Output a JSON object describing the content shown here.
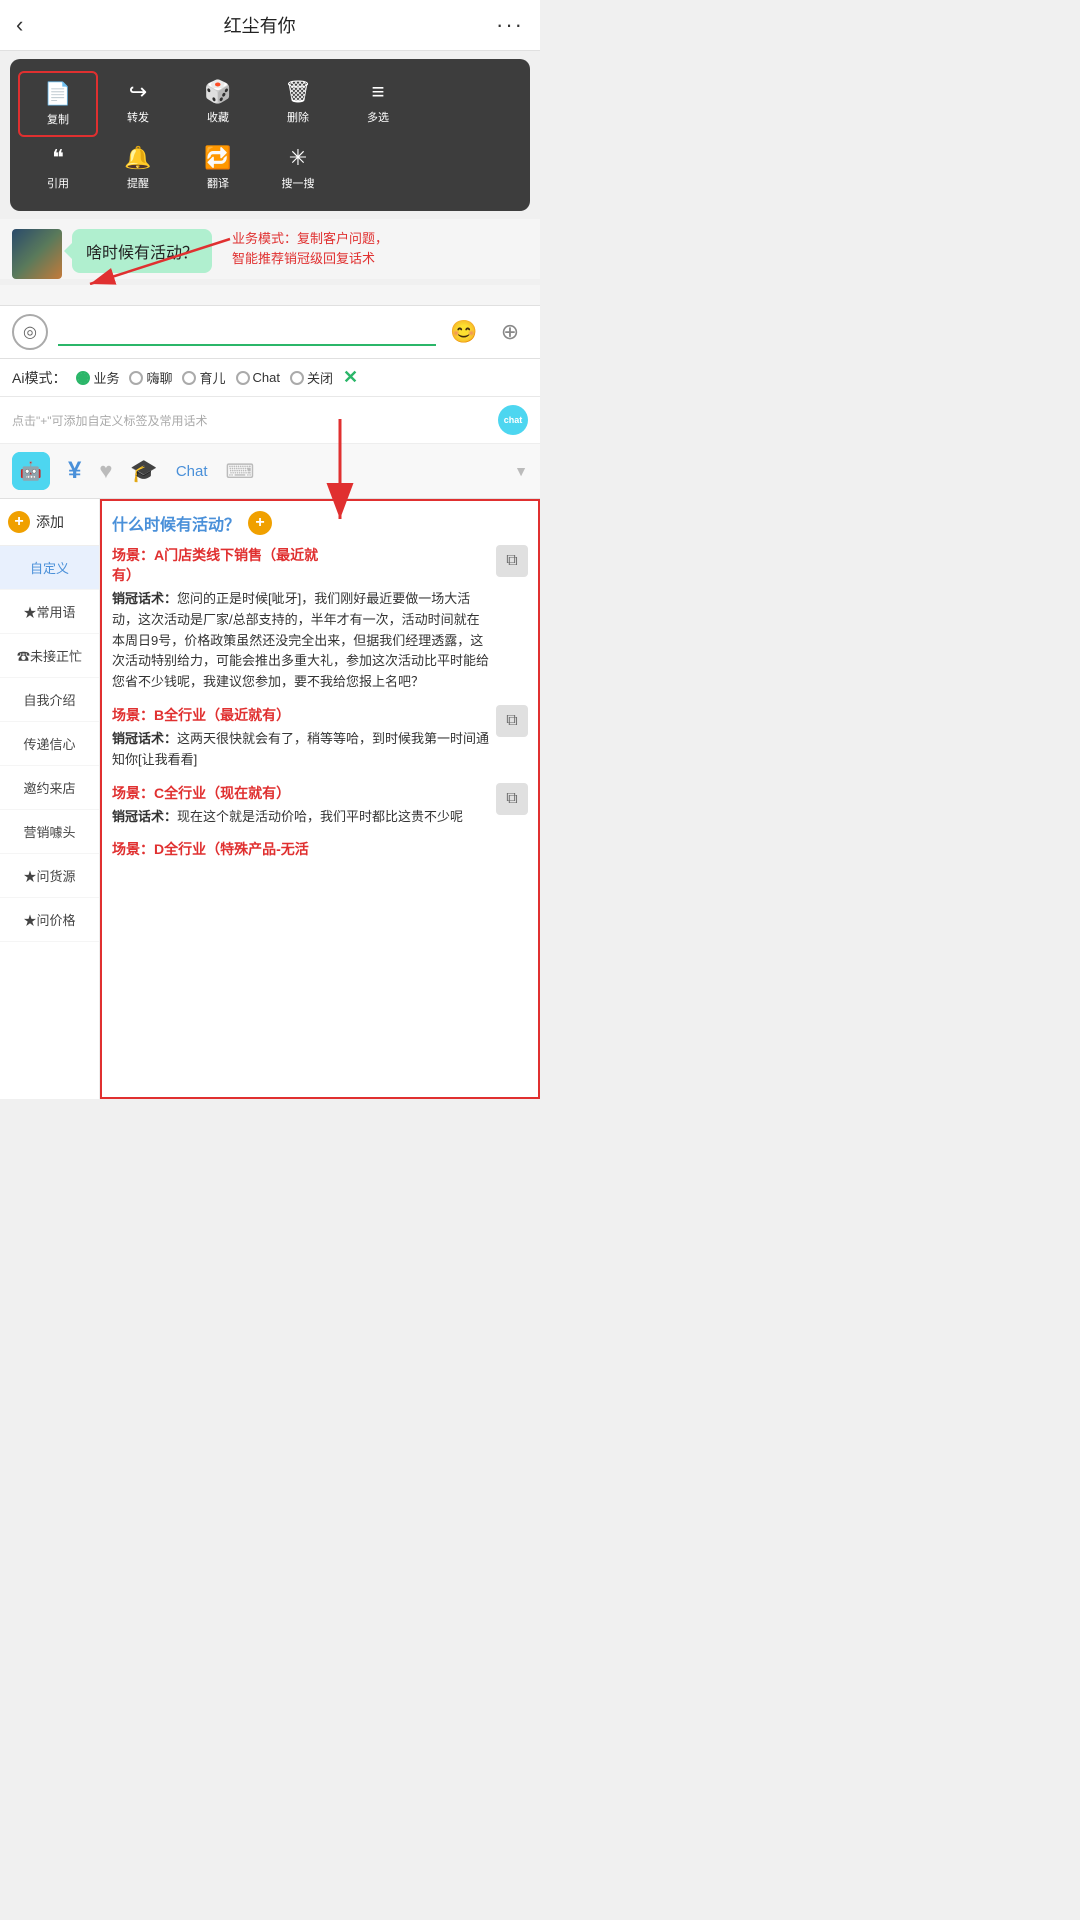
{
  "header": {
    "back_label": "‹",
    "title": "红尘有你",
    "more_label": "···"
  },
  "context_menu": {
    "row1": [
      {
        "id": "copy",
        "icon": "📄",
        "label": "复制",
        "selected": true
      },
      {
        "id": "forward",
        "icon": "↪",
        "label": "转发",
        "selected": false
      },
      {
        "id": "collect",
        "icon": "🎲",
        "label": "收藏",
        "selected": false
      },
      {
        "id": "delete",
        "icon": "🗑",
        "label": "删除",
        "selected": false
      },
      {
        "id": "multiselect",
        "icon": "≡",
        "label": "多选",
        "selected": false
      }
    ],
    "row2": [
      {
        "id": "quote",
        "icon": "❝",
        "label": "引用",
        "selected": false
      },
      {
        "id": "remind",
        "icon": "🔔",
        "label": "提醒",
        "selected": false
      },
      {
        "id": "translate",
        "icon": "🔁",
        "label": "翻译",
        "selected": false
      },
      {
        "id": "search",
        "icon": "✳",
        "label": "搜一搜",
        "selected": false
      }
    ]
  },
  "chat": {
    "bubble_text": "啥时候有活动？",
    "annotation": "业务模式：复制客户问题，\n智能推荐销冠级回复话术"
  },
  "input": {
    "placeholder": "",
    "voice_icon": "◎",
    "emoji_icon": "😊",
    "plus_icon": "+"
  },
  "ai_mode": {
    "label": "Ai模式：",
    "options": [
      {
        "id": "business",
        "label": "业务",
        "active": true
      },
      {
        "id": "chat",
        "label": "嗨聊",
        "active": false
      },
      {
        "id": "parenting",
        "label": "育儿",
        "active": false
      },
      {
        "id": "chat2",
        "label": "Chat",
        "active": false
      },
      {
        "id": "off",
        "label": "关闭",
        "active": false
      }
    ],
    "close_label": "✕"
  },
  "tips": {
    "text": "点击\"+\"可添加自定义标签及常用话术"
  },
  "tool_tabs": [
    {
      "id": "robot",
      "label": "chat",
      "type": "robot"
    },
    {
      "id": "money",
      "label": "¥",
      "type": "money"
    },
    {
      "id": "heart",
      "label": "♥",
      "type": "heart"
    },
    {
      "id": "hat",
      "label": "🎓",
      "type": "hat"
    },
    {
      "id": "chat_text",
      "label": "Chat",
      "type": "text"
    },
    {
      "id": "keyboard",
      "label": "⌨",
      "type": "keyboard"
    },
    {
      "id": "arrow",
      "label": "▼",
      "type": "arrow"
    }
  ],
  "sidebar": {
    "add_label": "添加",
    "items": [
      {
        "id": "custom",
        "label": "自定义",
        "active": true
      },
      {
        "id": "common",
        "label": "★常用语",
        "active": false
      },
      {
        "id": "busy",
        "label": "☎未接正忙",
        "active": false
      },
      {
        "id": "intro",
        "label": "自我介绍",
        "active": false
      },
      {
        "id": "confidence",
        "label": "传递信心",
        "active": false
      },
      {
        "id": "invite",
        "label": "邀约来店",
        "active": false
      },
      {
        "id": "marketing",
        "label": "营销噱头",
        "active": false
      },
      {
        "id": "source",
        "label": "★问货源",
        "active": false
      },
      {
        "id": "price",
        "label": "★问价格",
        "active": false
      }
    ]
  },
  "right_panel": {
    "question": "什么时候有活动？",
    "scripts": [
      {
        "id": "scene_a",
        "scene_label": "场景：A门店类线下销售（最近就有）",
        "script": "销冠话术：您问的正是时候[呲牙]，我们刚好最近要做一场大活动，这次活动是厂家/总部支持的，半年才有一次，活动时间就在本周日9号，价格政策虽然还没完全出来，但据我们经理透露，这次活动特别给力，可能会推出多重大礼，参加这次活动比平时能给您省不少钱呢，我建议您参加，要不我给您报上名吧？"
      },
      {
        "id": "scene_b",
        "scene_label": "场景：B全行业（最近就有）",
        "script": "销冠话术：这两天很快就会有了，稍等等哈，到时候我第一时间通知你[让我看看]"
      },
      {
        "id": "scene_c",
        "scene_label": "场景：C全行业（现在就有）",
        "script": "销冠话术：现在这个就是活动价哈，我们平时都比这贵不少呢"
      },
      {
        "id": "scene_d",
        "scene_label": "场景：D全行业（特殊产品-无活",
        "script": ""
      }
    ]
  }
}
